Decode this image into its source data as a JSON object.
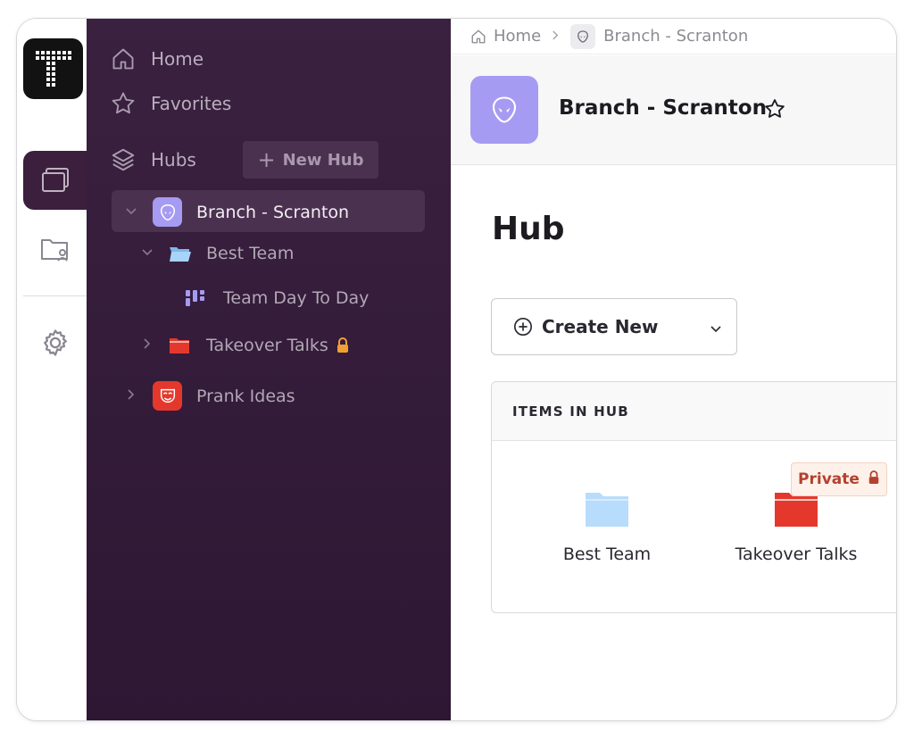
{
  "logo": {
    "letter": "T"
  },
  "sidebar": {
    "home_label": "Home",
    "favorites_label": "Favorites",
    "hubs_label": "Hubs",
    "new_hub_label": "New Hub",
    "new_hub_plus": "+",
    "tree": [
      {
        "label": "Branch - Scranton",
        "icon": "alien-icon",
        "color": "#a69bf2",
        "expanded": true,
        "selected": true
      },
      {
        "label": "Best Team",
        "icon": "folder-open-icon",
        "color": "#9fd0f7",
        "expanded": true
      },
      {
        "label": "Team Day To Day",
        "icon": "board-icon",
        "color": "#a69bf2"
      },
      {
        "label": "Takeover Talks",
        "icon": "folder-icon",
        "color": "#e5382c",
        "locked": true
      },
      {
        "label": "Prank Ideas",
        "icon": "mask-icon",
        "color": "#e5382c",
        "expanded": false
      }
    ]
  },
  "breadcrumb": {
    "home": "Home",
    "current": "Branch - Scranton"
  },
  "hub": {
    "title": "Branch - Scranton"
  },
  "page": {
    "title": "Hub"
  },
  "create": {
    "label": "Create New"
  },
  "items": {
    "header": "ITEMS IN HUB",
    "list": [
      {
        "name": "Best Team",
        "color": "#b8dcfb"
      },
      {
        "name": "Takeover Talks",
        "color": "#e5382c",
        "badge": "Private"
      }
    ]
  },
  "colors": {
    "sidebar_bg": "#3a2140",
    "accent_purple": "#a69bf2",
    "danger_red": "#e5382c",
    "lock_orange": "#f0a032"
  }
}
